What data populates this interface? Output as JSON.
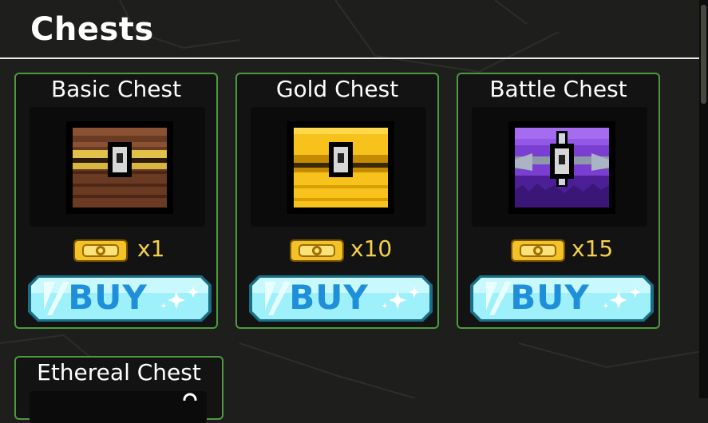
{
  "header": {
    "title": "Chests"
  },
  "chests": [
    {
      "name": "Basic Chest",
      "price": "x1",
      "buy_label": "BUY",
      "icon": "basic-chest-icon",
      "color": "#6b3a22"
    },
    {
      "name": "Gold Chest",
      "price": "x10",
      "buy_label": "BUY",
      "icon": "gold-chest-icon",
      "color": "#f7c21c"
    },
    {
      "name": "Battle Chest",
      "price": "x15",
      "buy_label": "BUY",
      "icon": "battle-chest-icon",
      "color": "#7a3fd0"
    }
  ],
  "partial_chest": {
    "name": "Ethereal Chest"
  },
  "colors": {
    "card_border": "#4d9a3e",
    "price_text": "#f4d14a",
    "buy_text": "#1f8fd9",
    "buy_button": "#9ef0fb"
  }
}
